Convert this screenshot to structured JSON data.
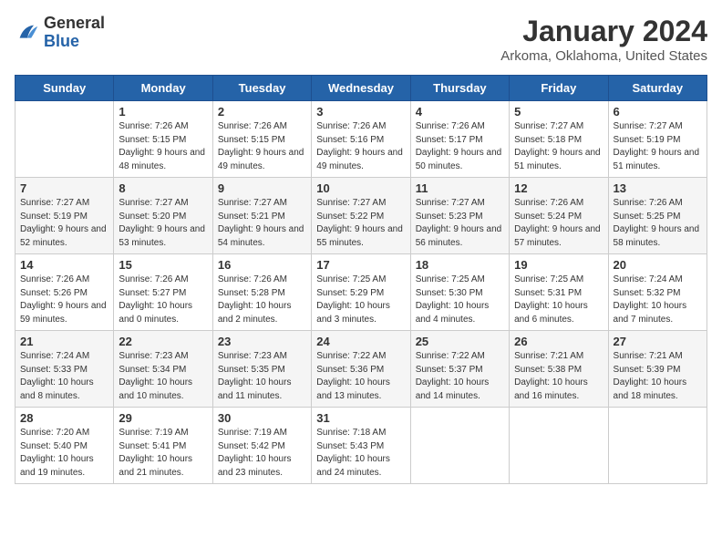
{
  "header": {
    "logo_line1": "General",
    "logo_line2": "Blue",
    "title": "January 2024",
    "subtitle": "Arkoma, Oklahoma, United States"
  },
  "weekdays": [
    "Sunday",
    "Monday",
    "Tuesday",
    "Wednesday",
    "Thursday",
    "Friday",
    "Saturday"
  ],
  "weeks": [
    [
      {
        "day": "",
        "sunrise": "",
        "sunset": "",
        "daylight": ""
      },
      {
        "day": "1",
        "sunrise": "7:26 AM",
        "sunset": "5:15 PM",
        "daylight": "9 hours and 48 minutes."
      },
      {
        "day": "2",
        "sunrise": "7:26 AM",
        "sunset": "5:15 PM",
        "daylight": "9 hours and 49 minutes."
      },
      {
        "day": "3",
        "sunrise": "7:26 AM",
        "sunset": "5:16 PM",
        "daylight": "9 hours and 49 minutes."
      },
      {
        "day": "4",
        "sunrise": "7:26 AM",
        "sunset": "5:17 PM",
        "daylight": "9 hours and 50 minutes."
      },
      {
        "day": "5",
        "sunrise": "7:27 AM",
        "sunset": "5:18 PM",
        "daylight": "9 hours and 51 minutes."
      },
      {
        "day": "6",
        "sunrise": "7:27 AM",
        "sunset": "5:19 PM",
        "daylight": "9 hours and 51 minutes."
      }
    ],
    [
      {
        "day": "7",
        "sunrise": "7:27 AM",
        "sunset": "5:19 PM",
        "daylight": "9 hours and 52 minutes."
      },
      {
        "day": "8",
        "sunrise": "7:27 AM",
        "sunset": "5:20 PM",
        "daylight": "9 hours and 53 minutes."
      },
      {
        "day": "9",
        "sunrise": "7:27 AM",
        "sunset": "5:21 PM",
        "daylight": "9 hours and 54 minutes."
      },
      {
        "day": "10",
        "sunrise": "7:27 AM",
        "sunset": "5:22 PM",
        "daylight": "9 hours and 55 minutes."
      },
      {
        "day": "11",
        "sunrise": "7:27 AM",
        "sunset": "5:23 PM",
        "daylight": "9 hours and 56 minutes."
      },
      {
        "day": "12",
        "sunrise": "7:26 AM",
        "sunset": "5:24 PM",
        "daylight": "9 hours and 57 minutes."
      },
      {
        "day": "13",
        "sunrise": "7:26 AM",
        "sunset": "5:25 PM",
        "daylight": "9 hours and 58 minutes."
      }
    ],
    [
      {
        "day": "14",
        "sunrise": "7:26 AM",
        "sunset": "5:26 PM",
        "daylight": "9 hours and 59 minutes."
      },
      {
        "day": "15",
        "sunrise": "7:26 AM",
        "sunset": "5:27 PM",
        "daylight": "10 hours and 0 minutes."
      },
      {
        "day": "16",
        "sunrise": "7:26 AM",
        "sunset": "5:28 PM",
        "daylight": "10 hours and 2 minutes."
      },
      {
        "day": "17",
        "sunrise": "7:25 AM",
        "sunset": "5:29 PM",
        "daylight": "10 hours and 3 minutes."
      },
      {
        "day": "18",
        "sunrise": "7:25 AM",
        "sunset": "5:30 PM",
        "daylight": "10 hours and 4 minutes."
      },
      {
        "day": "19",
        "sunrise": "7:25 AM",
        "sunset": "5:31 PM",
        "daylight": "10 hours and 6 minutes."
      },
      {
        "day": "20",
        "sunrise": "7:24 AM",
        "sunset": "5:32 PM",
        "daylight": "10 hours and 7 minutes."
      }
    ],
    [
      {
        "day": "21",
        "sunrise": "7:24 AM",
        "sunset": "5:33 PM",
        "daylight": "10 hours and 8 minutes."
      },
      {
        "day": "22",
        "sunrise": "7:23 AM",
        "sunset": "5:34 PM",
        "daylight": "10 hours and 10 minutes."
      },
      {
        "day": "23",
        "sunrise": "7:23 AM",
        "sunset": "5:35 PM",
        "daylight": "10 hours and 11 minutes."
      },
      {
        "day": "24",
        "sunrise": "7:22 AM",
        "sunset": "5:36 PM",
        "daylight": "10 hours and 13 minutes."
      },
      {
        "day": "25",
        "sunrise": "7:22 AM",
        "sunset": "5:37 PM",
        "daylight": "10 hours and 14 minutes."
      },
      {
        "day": "26",
        "sunrise": "7:21 AM",
        "sunset": "5:38 PM",
        "daylight": "10 hours and 16 minutes."
      },
      {
        "day": "27",
        "sunrise": "7:21 AM",
        "sunset": "5:39 PM",
        "daylight": "10 hours and 18 minutes."
      }
    ],
    [
      {
        "day": "28",
        "sunrise": "7:20 AM",
        "sunset": "5:40 PM",
        "daylight": "10 hours and 19 minutes."
      },
      {
        "day": "29",
        "sunrise": "7:19 AM",
        "sunset": "5:41 PM",
        "daylight": "10 hours and 21 minutes."
      },
      {
        "day": "30",
        "sunrise": "7:19 AM",
        "sunset": "5:42 PM",
        "daylight": "10 hours and 23 minutes."
      },
      {
        "day": "31",
        "sunrise": "7:18 AM",
        "sunset": "5:43 PM",
        "daylight": "10 hours and 24 minutes."
      },
      {
        "day": "",
        "sunrise": "",
        "sunset": "",
        "daylight": ""
      },
      {
        "day": "",
        "sunrise": "",
        "sunset": "",
        "daylight": ""
      },
      {
        "day": "",
        "sunrise": "",
        "sunset": "",
        "daylight": ""
      }
    ]
  ]
}
